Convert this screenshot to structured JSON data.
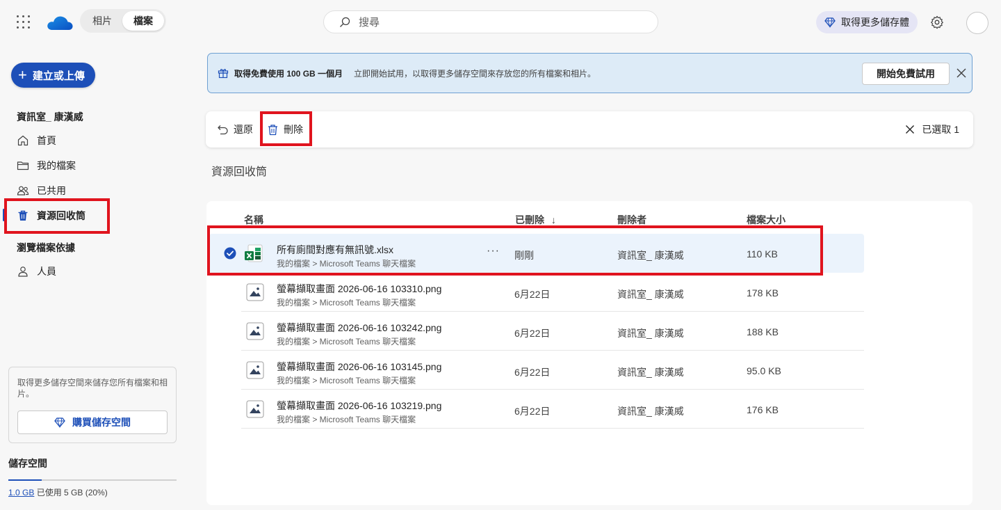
{
  "topbar": {
    "tabs": [
      {
        "label": "相片",
        "active": false
      },
      {
        "label": "檔案",
        "active": true
      }
    ],
    "search_placeholder": "搜尋",
    "premium_label": "取得更多儲存體"
  },
  "sidebar": {
    "create_label": "建立或上傳",
    "account_name": "資訊室_ 康漢威",
    "items": [
      {
        "label": "首頁",
        "icon": "home-icon"
      },
      {
        "label": "我的檔案",
        "icon": "folder-icon"
      },
      {
        "label": "已共用",
        "icon": "people-icon"
      },
      {
        "label": "資源回收筒",
        "icon": "recycle-bin-icon",
        "active": true
      }
    ],
    "browse_title": "瀏覽檔案依據",
    "browse_items": [
      {
        "label": "人員",
        "icon": "person-icon"
      }
    ],
    "storage_card_text": "取得更多儲存空間來儲存您所有檔案和相片。",
    "buy_storage_label": "購買儲存空間",
    "storage_title": "儲存空間",
    "storage_used": "1.0 GB",
    "storage_detail": "已使用 5 GB (20%)",
    "storage_fraction": 0.2
  },
  "promo": {
    "bold_text": "取得免費使用 100 GB 一個月",
    "text": "立即開始試用，以取得更多儲存空間來存放您的所有檔案和相片。",
    "button_label": "開始免費試用"
  },
  "command_bar": {
    "restore_label": "還原",
    "delete_label": "刪除",
    "selected_label": "已選取 1"
  },
  "page_title": "資源回收筒",
  "table": {
    "headers": {
      "name": "名稱",
      "deleted": "已刪除",
      "sort_arrow": "↓",
      "deleted_by": "刪除者",
      "size": "檔案大小"
    },
    "rows": [
      {
        "name": "所有廁間對應有無訊號.xlsx",
        "path": "我的檔案 > Microsoft Teams 聊天檔案",
        "deleted": "剛剛",
        "deleted_by": "資訊室_ 康漢威",
        "size": "110 KB",
        "type": "excel",
        "selected": true,
        "more": "···"
      },
      {
        "name": "螢幕擷取畫面 2026-06-16 103310.png",
        "path": "我的檔案 > Microsoft Teams 聊天檔案",
        "deleted": "6月22日",
        "deleted_by": "資訊室_ 康漢威",
        "size": "178 KB",
        "type": "image"
      },
      {
        "name": "螢幕擷取畫面 2026-06-16 103242.png",
        "path": "我的檔案 > Microsoft Teams 聊天檔案",
        "deleted": "6月22日",
        "deleted_by": "資訊室_ 康漢威",
        "size": "188 KB",
        "type": "image"
      },
      {
        "name": "螢幕擷取畫面 2026-06-16 103145.png",
        "path": "我的檔案 > Microsoft Teams 聊天檔案",
        "deleted": "6月22日",
        "deleted_by": "資訊室_ 康漢威",
        "size": "95.0 KB",
        "type": "image"
      },
      {
        "name": "螢幕擷取畫面 2026-06-16 103219.png",
        "path": "我的檔案 > Microsoft Teams 聊天檔案",
        "deleted": "6月22日",
        "deleted_by": "資訊室_ 康漢威",
        "size": "176 KB",
        "type": "image"
      }
    ]
  },
  "colors": {
    "accent": "#1d4fb8",
    "highlight_box": "#e0141e",
    "selected_row": "#ebf3fc"
  }
}
